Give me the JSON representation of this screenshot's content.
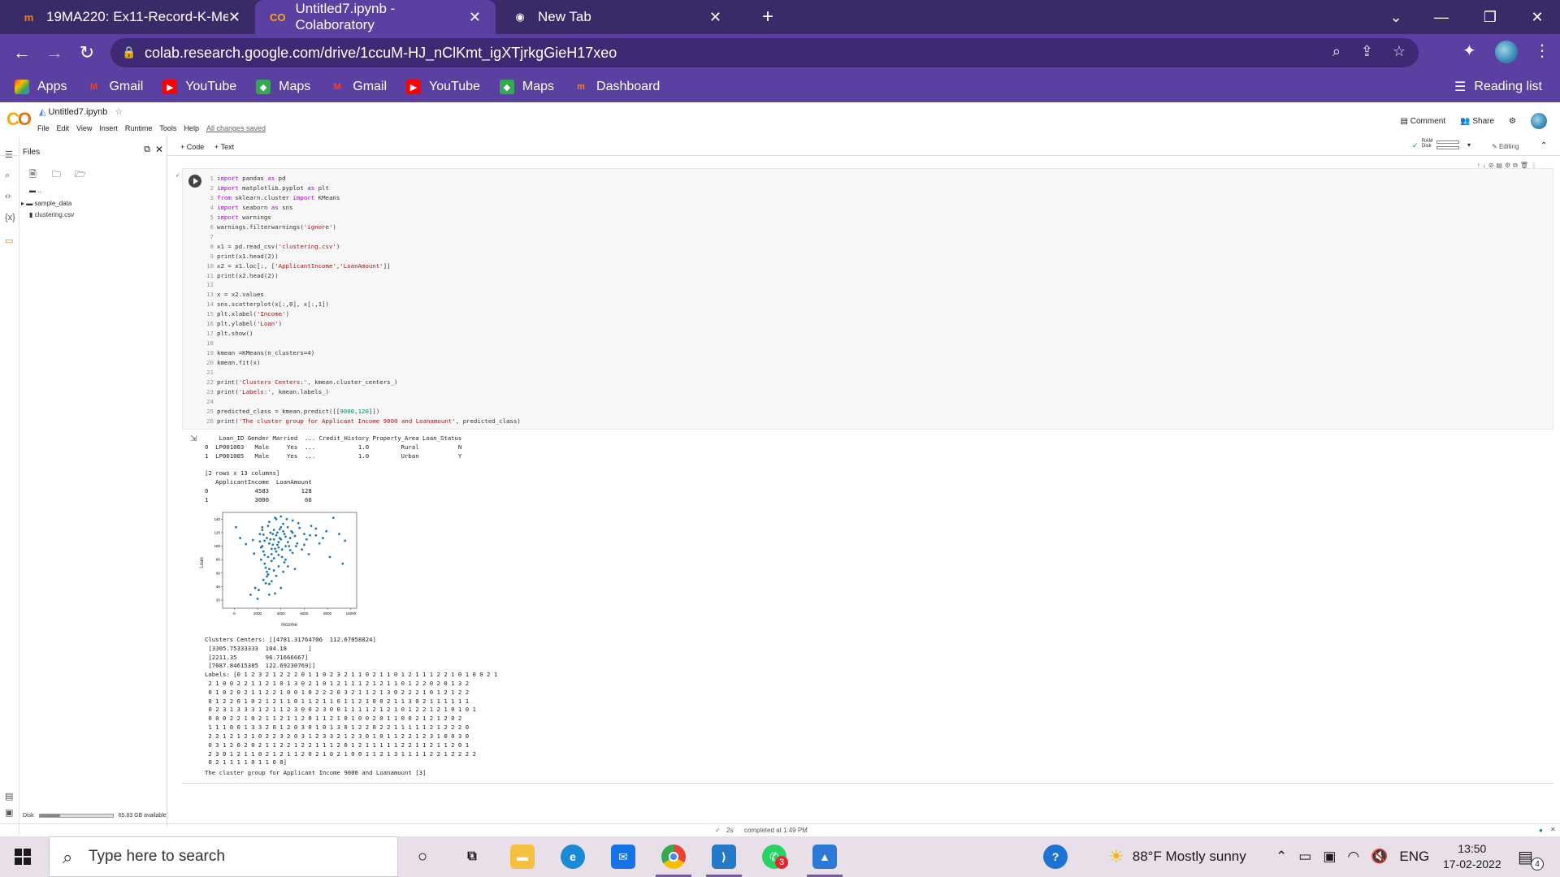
{
  "browser": {
    "tabs": [
      {
        "title": "19MA220: Ex11-Record-K-Means",
        "favicon": "moodle-icon"
      },
      {
        "title": "Untitled7.ipynb - Colaboratory",
        "favicon": "colab-icon"
      },
      {
        "title": "New Tab",
        "favicon": "chrome-icon"
      }
    ],
    "url": "colab.research.google.com/drive/1ccuM-HJ_nClKmt_igXTjrkgGieH17xeo",
    "bookmarks": [
      "Apps",
      "Gmail",
      "YouTube",
      "Maps",
      "Gmail",
      "YouTube",
      "Maps",
      "Dashboard"
    ],
    "reading_list": "Reading list"
  },
  "colab": {
    "notebook_title": "Untitled7.ipynb",
    "menus": [
      "File",
      "Edit",
      "View",
      "Insert",
      "Runtime",
      "Tools",
      "Help"
    ],
    "saved_status": "All changes saved",
    "comment": "Comment",
    "share": "Share",
    "add_code": "+ Code",
    "add_text": "+ Text",
    "ram": "RAM",
    "disk_lbl": "Disk",
    "editing": "Editing",
    "files_title": "Files",
    "files": [
      "..",
      "sample_data",
      "clustering.csv"
    ],
    "disk_text": "Disk",
    "disk_available": "65.83 GB available",
    "disk_fill": 0.28,
    "exec_time": "2s",
    "completed": "completed at 1:49 PM"
  },
  "code_lines": [
    "import pandas as pd",
    "import matplotlib.pyplot as plt",
    "from sklearn.cluster import KMeans",
    "import seaborn as sns",
    "import warnings",
    "warnings.filterwarnings('ignore')",
    "",
    "x1 = pd.read_csv('clustering.csv')",
    "print(x1.head(2))",
    "x2 = x1.loc[:, ['ApplicantIncome','LoanAmount']]",
    "print(x2.head(2))",
    "",
    "x = x2.values",
    "sns.scatterplot(x[:,0], x[:,1])",
    "plt.xlabel('Income')",
    "plt.ylabel('Loan')",
    "plt.show()",
    "",
    "kmean =KMeans(n_clusters=4)",
    "kmean.fit(x)",
    "",
    "print('Clusters Centers:', kmean.cluster_centers_)",
    "print('Labels:', kmean.labels_)",
    "",
    "predicted_class = kmean.predict([[9000,120]])",
    "print('The cluster group for Applicant Income 9000 and Loanamount', predicted_class)"
  ],
  "output": {
    "head1": "    Loan_ID Gender Married  ... Credit_History Property_Area Loan_Status\n0  LP001003   Male     Yes  ...            1.0         Rural           N\n1  LP001005   Male     Yes  ...            1.0         Urban           Y\n\n[2 rows x 13 columns]\n   ApplicantIncome  LoanAmount\n0             4583         128\n1             3000          66",
    "centers": "Clusters Centers: [[4781.31764706  112.67058824]\n [3305.75333333  104.18      ]\n [2211.35        96.71666667]\n [7087.84615385  122.69230769]]",
    "labels": "Labels: [0 1 2 3 2 1 2 2 2 0 1 1 0 2 3 2 1 1 0 2 1 1 0 1 2 1 1 1 2 2 1 0 1 0 0 2 1\n 2 1 0 0 2 2 1 1 2 1 0 1 3 0 2 1 0 1 2 1 1 1 2 1 2 1 1 0 1 2 2 0 2 0 1 3 2\n 0 1 0 2 0 2 1 1 2 2 1 0 0 1 0 2 2 2 0 3 2 1 1 2 1 3 0 2 2 2 1 0 1 2 1 2 2\n 0 1 2 2 0 1 0 2 1 2 1 1 0 1 1 2 1 1 0 1 1 2 1 0 0 2 1 1 3 0 2 1 1 1 1 1 1\n 0 2 3 1 3 3 3 1 2 1 1 2 3 0 0 2 3 0 0 1 1 1 1 2 1 2 1 0 1 2 2 1 2 1 0 1 0 1\n 0 0 0 2 2 1 0 2 1 1 2 1 1 2 0 1 1 2 1 0 1 0 0 2 0 1 1 0 0 2 1 2 1 2 0 2\n 1 1 1 0 0 1 3 3 2 0 1 2 0 3 0 1 0 1 3 0 1 2 2 0 2 2 1 1 1 1 1 2 1 2 2 2 0\n 2 2 1 2 1 2 1 0 2 2 3 2 0 3 1 2 3 3 2 1 2 3 0 1 0 1 1 2 2 1 2 3 1 0 0 3 0\n 0 3 1 2 0 2 0 2 1 1 2 2 1 2 2 1 1 1 2 0 1 2 1 1 1 1 1 2 2 1 1 2 1 1 2 0 1\n 2 3 0 1 2 1 1 0 2 1 2 1 1 2 0 2 1 0 2 1 0 0 1 1 2 1 3 1 1 1 1 2 2 1 2 2 2 2\n 0 2 1 1 1 1 0 1 1 0 0]",
    "result": "The cluster group for Applicant Income 9000 and Loanamount [3]"
  },
  "chart_data": {
    "type": "scatter",
    "xlabel": "Income",
    "ylabel": "Loan",
    "xlim": [
      -1000,
      10500
    ],
    "ylim": [
      8,
      150
    ],
    "xticks": [
      0,
      2000,
      4000,
      6000,
      8000,
      10000
    ],
    "yticks": [
      20,
      40,
      60,
      80,
      100,
      120,
      140
    ],
    "points": [
      [
        150,
        128
      ],
      [
        1600,
        109
      ],
      [
        500,
        112
      ],
      [
        1000,
        103
      ],
      [
        1700,
        89
      ],
      [
        1800,
        38
      ],
      [
        1400,
        28
      ],
      [
        2000,
        22
      ],
      [
        2100,
        35
      ],
      [
        2200,
        107
      ],
      [
        2300,
        98
      ],
      [
        2400,
        128
      ],
      [
        2500,
        117
      ],
      [
        2600,
        87
      ],
      [
        2700,
        68
      ],
      [
        2800,
        55
      ],
      [
        2900,
        130
      ],
      [
        3000,
        66
      ],
      [
        3100,
        120
      ],
      [
        3200,
        78
      ],
      [
        3300,
        118
      ],
      [
        3400,
        110
      ],
      [
        3500,
        96
      ],
      [
        3600,
        140
      ],
      [
        3700,
        102
      ],
      [
        3800,
        87
      ],
      [
        3900,
        125
      ],
      [
        4000,
        110
      ],
      [
        4100,
        95
      ],
      [
        4200,
        133
      ],
      [
        4300,
        118
      ],
      [
        4400,
        80
      ],
      [
        4583,
        128
      ],
      [
        4700,
        100
      ],
      [
        4800,
        112
      ],
      [
        4900,
        122
      ],
      [
        5000,
        90
      ],
      [
        5200,
        115
      ],
      [
        5400,
        104
      ],
      [
        5600,
        127
      ],
      [
        5800,
        95
      ],
      [
        6000,
        118
      ],
      [
        6200,
        110
      ],
      [
        6400,
        88
      ],
      [
        6600,
        130
      ],
      [
        7000,
        116
      ],
      [
        7300,
        104
      ],
      [
        7600,
        112
      ],
      [
        7900,
        122
      ],
      [
        8200,
        84
      ],
      [
        8500,
        142
      ],
      [
        9000,
        118
      ],
      [
        9300,
        74
      ],
      [
        9500,
        108
      ],
      [
        2500,
        50
      ],
      [
        2700,
        45
      ],
      [
        2900,
        58
      ],
      [
        3000,
        44
      ],
      [
        2800,
        62
      ],
      [
        2600,
        74
      ],
      [
        3200,
        48
      ],
      [
        3400,
        64
      ],
      [
        3600,
        56
      ],
      [
        3800,
        70
      ],
      [
        4000,
        38
      ],
      [
        4200,
        62
      ],
      [
        3500,
        30
      ],
      [
        3000,
        28
      ],
      [
        2400,
        100
      ],
      [
        2600,
        108
      ],
      [
        2800,
        112
      ],
      [
        3000,
        104
      ],
      [
        3200,
        96
      ],
      [
        3400,
        124
      ],
      [
        3600,
        116
      ],
      [
        3800,
        106
      ],
      [
        4000,
        128
      ],
      [
        4200,
        122
      ],
      [
        4400,
        114
      ],
      [
        4600,
        106
      ],
      [
        5000,
        120
      ],
      [
        5500,
        134
      ],
      [
        6000,
        102
      ],
      [
        6500,
        116
      ],
      [
        7000,
        126
      ],
      [
        2200,
        118
      ],
      [
        2400,
        124
      ],
      [
        3000,
        136
      ],
      [
        3500,
        142
      ],
      [
        4000,
        144
      ],
      [
        4500,
        140
      ],
      [
        5000,
        138
      ],
      [
        3200,
        88
      ],
      [
        3400,
        82
      ],
      [
        3600,
        92
      ],
      [
        3800,
        98
      ],
      [
        4100,
        84
      ],
      [
        4300,
        76
      ],
      [
        4600,
        70
      ],
      [
        5200,
        66
      ],
      [
        2900,
        84
      ],
      [
        2300,
        80
      ],
      [
        2500,
        92
      ],
      [
        3100,
        110
      ],
      [
        3300,
        102
      ],
      [
        3700,
        120
      ],
      [
        3900,
        112
      ],
      [
        4400,
        100
      ],
      [
        4800,
        94
      ],
      [
        5300,
        100
      ]
    ]
  }
}
